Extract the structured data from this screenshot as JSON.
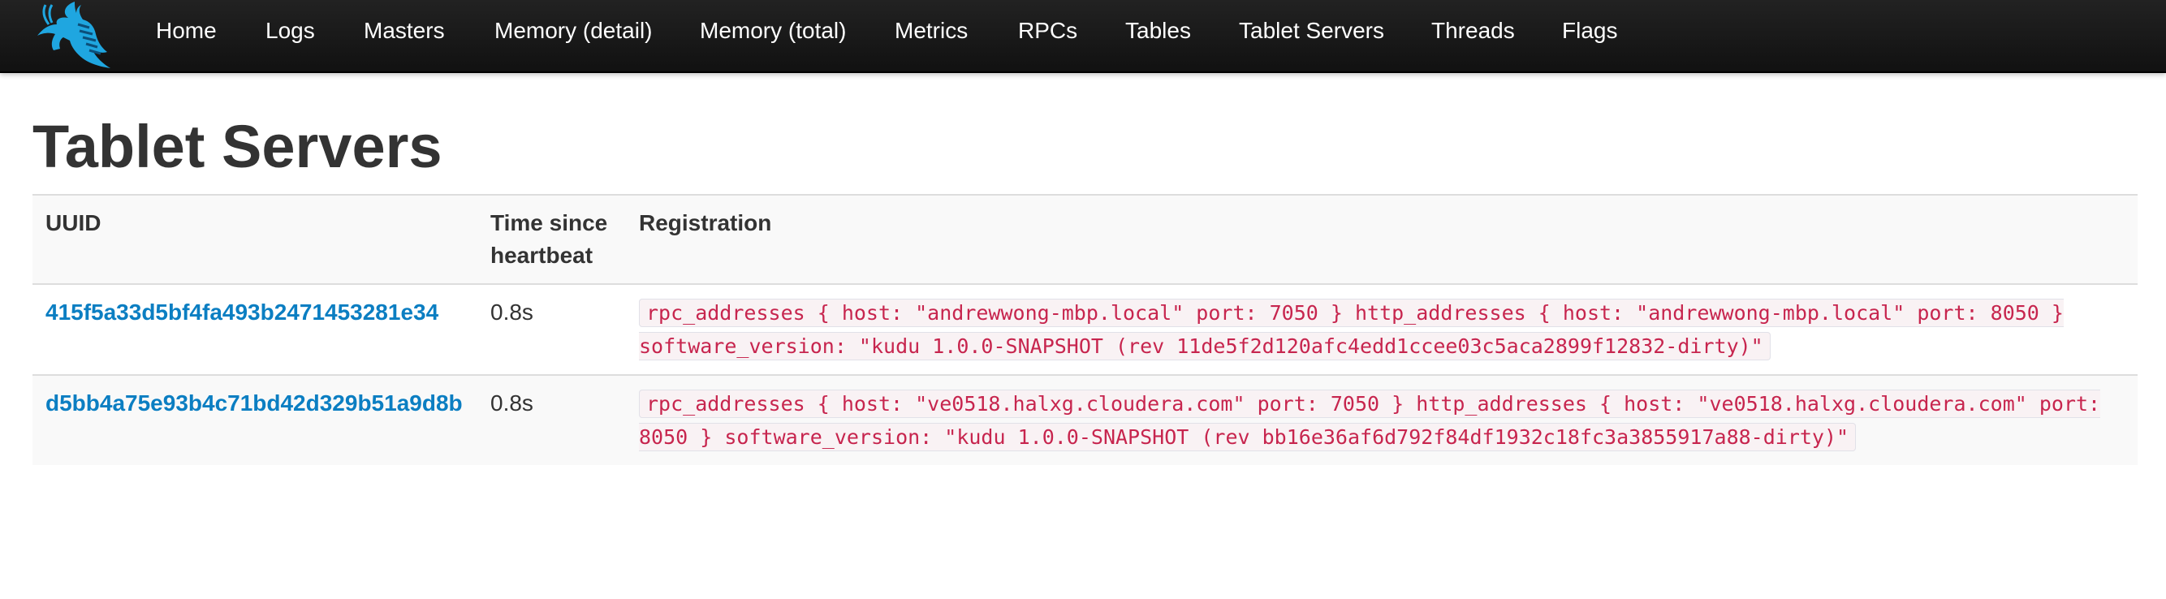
{
  "navbar": {
    "logo_icon": "kudu-antelope-logo-icon",
    "items": [
      {
        "label": "Home"
      },
      {
        "label": "Logs"
      },
      {
        "label": "Masters"
      },
      {
        "label": "Memory (detail)"
      },
      {
        "label": "Memory (total)"
      },
      {
        "label": "Metrics"
      },
      {
        "label": "RPCs"
      },
      {
        "label": "Tables"
      },
      {
        "label": "Tablet Servers"
      },
      {
        "label": "Threads"
      },
      {
        "label": "Flags"
      }
    ]
  },
  "page": {
    "title": "Tablet Servers"
  },
  "table": {
    "headers": {
      "uuid": "UUID",
      "heartbeat": "Time since heartbeat",
      "registration": "Registration"
    },
    "rows": [
      {
        "uuid": "415f5a33d5bf4fa493b2471453281e34",
        "heartbeat": "0.8s",
        "registration": "rpc_addresses { host: \"andrewwong-mbp.local\" port: 7050 } http_addresses { host: \"andrewwong-mbp.local\" port: 8050 } software_version: \"kudu 1.0.0-SNAPSHOT (rev 11de5f2d120afc4edd1ccee03c5aca2899f12832-dirty)\""
      },
      {
        "uuid": "d5bb4a75e93b4c71bd42d329b51a9d8b",
        "heartbeat": "0.8s",
        "registration": "rpc_addresses { host: \"ve0518.halxg.cloudera.com\" port: 7050 } http_addresses { host: \"ve0518.halxg.cloudera.com\" port: 8050 } software_version: \"kudu 1.0.0-SNAPSHOT (rev bb16e36af6d792f84df1932c18fc3a3855917a88-dirty)\""
      }
    ]
  },
  "colors": {
    "navbar_bg": "#1b1b1b",
    "logo_blue": "#1fa6e0",
    "link": "#0b7ec2",
    "code_text": "#c7254e"
  }
}
